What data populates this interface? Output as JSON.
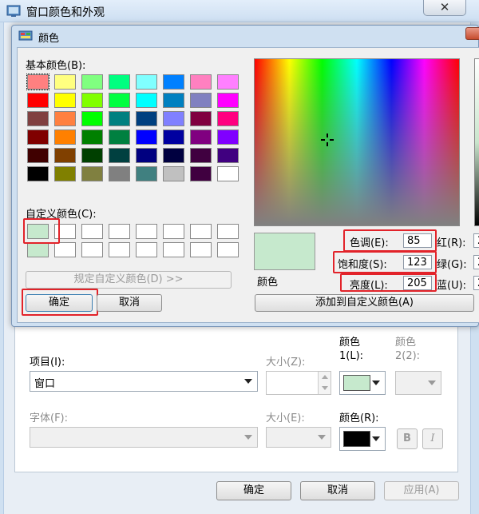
{
  "window": {
    "title": "窗口颜色和外观",
    "close_glyph": "✕"
  },
  "dialog": {
    "title": "颜色"
  },
  "basic_colors_label": "基本颜色(B):",
  "basic_colors": [
    [
      "#ff8080",
      "#ffff80",
      "#80ff80",
      "#00ff80",
      "#80ffff",
      "#0080ff",
      "#ff80c0",
      "#ff80ff"
    ],
    [
      "#ff0000",
      "#ffff00",
      "#80ff00",
      "#00ff40",
      "#00ffff",
      "#0080c0",
      "#8080c0",
      "#ff00ff"
    ],
    [
      "#804040",
      "#ff8040",
      "#00ff00",
      "#008080",
      "#004080",
      "#8080ff",
      "#800040",
      "#ff0080"
    ],
    [
      "#800000",
      "#ff8000",
      "#008000",
      "#008040",
      "#0000ff",
      "#0000a0",
      "#800080",
      "#8000ff"
    ],
    [
      "#400000",
      "#804000",
      "#004000",
      "#004040",
      "#000080",
      "#000040",
      "#400040",
      "#400080"
    ],
    [
      "#000000",
      "#808000",
      "#808040",
      "#808080",
      "#408080",
      "#c0c0c0",
      "#400040",
      "#ffffff"
    ]
  ],
  "custom_colors_label": "自定义颜色(C):",
  "custom_colors": [
    [
      "#c6e9cd",
      "#ffffff",
      "#ffffff",
      "#ffffff",
      "#ffffff",
      "#ffffff",
      "#ffffff",
      "#ffffff"
    ],
    [
      "#c6e9cd",
      "#ffffff",
      "#ffffff",
      "#ffffff",
      "#ffffff",
      "#ffffff",
      "#ffffff",
      "#ffffff"
    ]
  ],
  "define_custom_label": "规定自定义颜色(D) >>",
  "ok_label": "确定",
  "cancel_label": "取消",
  "preview_label": "颜色",
  "preview_color": "#c6e9cd",
  "hue": {
    "label": "色调(E):",
    "value": "85"
  },
  "sat": {
    "label": "饱和度(S):",
    "value": "123"
  },
  "lum": {
    "label": "亮度(L):",
    "value": "205"
  },
  "red_label": "红(R):",
  "green_label": "绿(G):",
  "blue_label": "蓝(U):",
  "rgb_values": {
    "r": "2",
    "g": "2",
    "b": "2"
  },
  "add_custom_label": "添加到自定义颜色(A)",
  "panel": {
    "item_label": "项目(I):",
    "item_value": "窗口",
    "size_label": "大小(Z):",
    "color1_label": "颜色 1(L):",
    "color2_label": "颜色 2(2):",
    "font_label": "字体(F):",
    "font_size_label": "大小(E):",
    "font_color_label": "颜色(R):",
    "bold_label": "B",
    "italic_label": "I",
    "color1_value": "#c6e9cd",
    "font_color_value": "#000000"
  },
  "footer": {
    "ok": "确定",
    "cancel": "取消",
    "apply": "应用(A)"
  },
  "accent_red": "#e2232a"
}
